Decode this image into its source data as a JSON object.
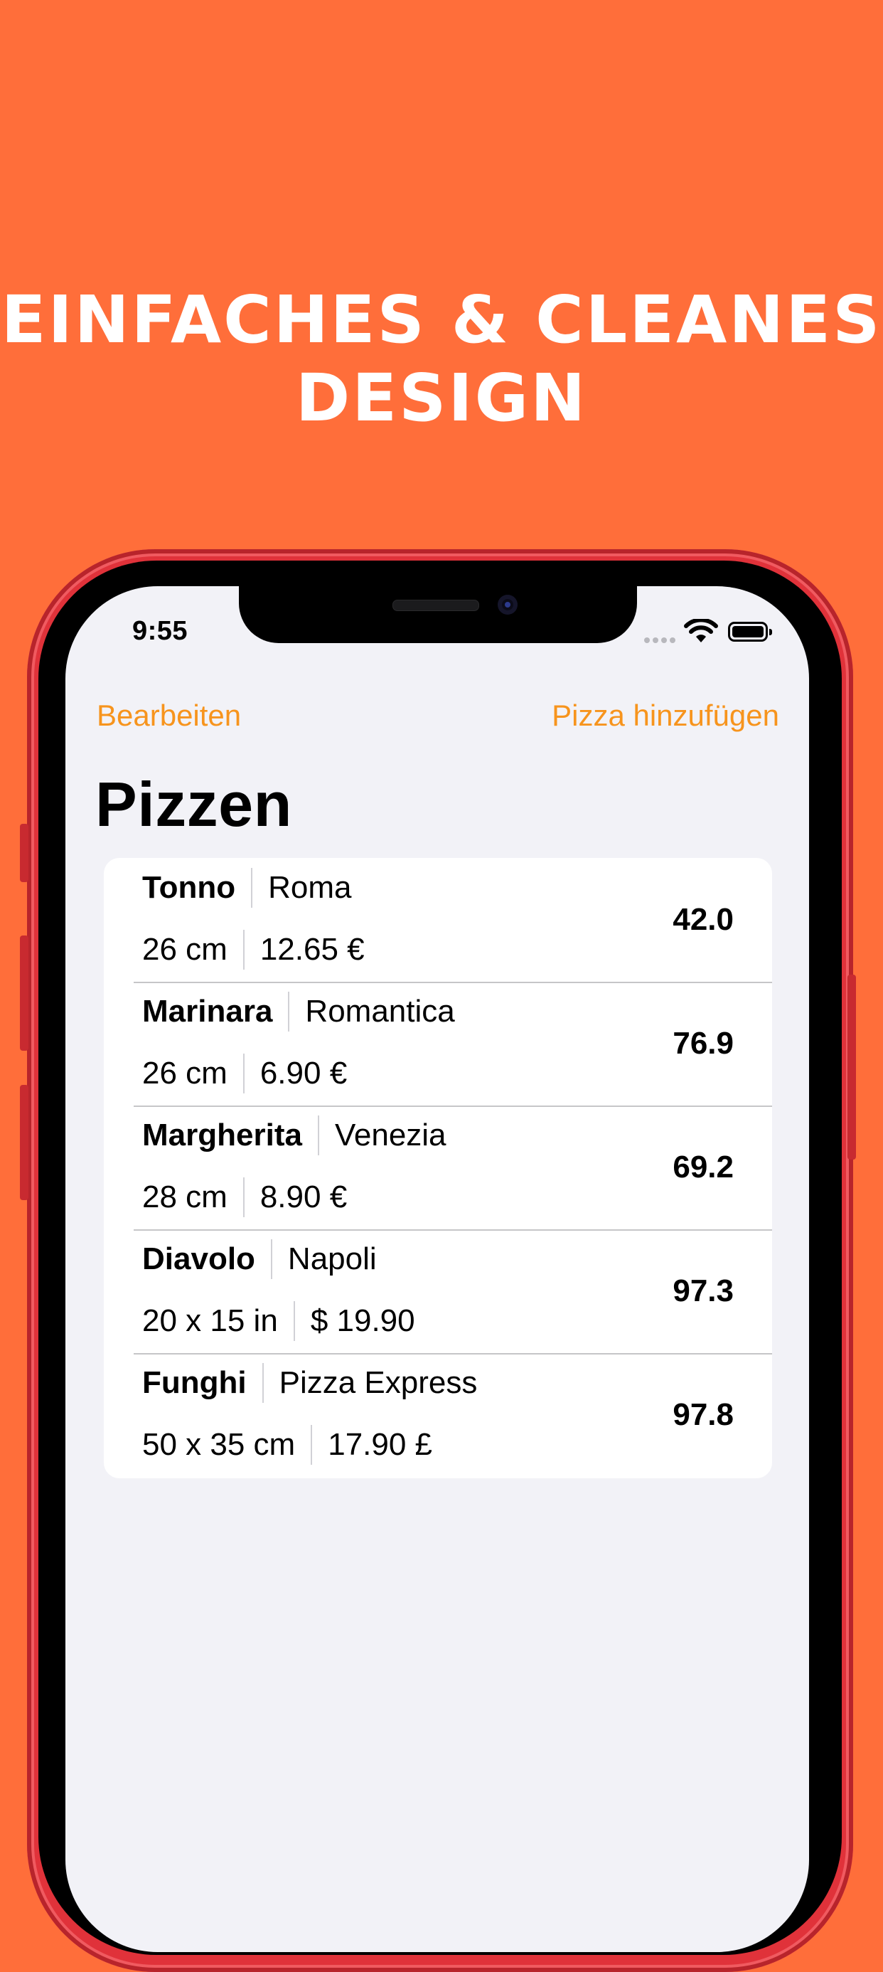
{
  "headline": {
    "line1": "EINFACHES & CLEANES",
    "line2": "DESIGN"
  },
  "status": {
    "time": "9:55"
  },
  "nav": {
    "edit_label": "Bearbeiten",
    "add_label": "Pizza hinzufügen",
    "title": "Pizzen"
  },
  "pizzas": [
    {
      "name": "Tonno",
      "restaurant": "Roma",
      "size": "26 cm",
      "price": "12.65 €",
      "rating": "42.0"
    },
    {
      "name": "Marinara",
      "restaurant": "Romantica",
      "size": "26 cm",
      "price": "6.90 €",
      "rating": "76.9"
    },
    {
      "name": "Margherita",
      "restaurant": "Venezia",
      "size": "28 cm",
      "price": "8.90 €",
      "rating": "69.2"
    },
    {
      "name": "Diavolo",
      "restaurant": "Napoli",
      "size": "20 x 15 in",
      "price": "$ 19.90",
      "rating": "97.3"
    },
    {
      "name": "Funghi",
      "restaurant": "Pizza Express",
      "size": "50 x 35 cm",
      "price": "17.90 £",
      "rating": "97.8"
    }
  ],
  "colors": {
    "background": "#FF6E3A",
    "accent": "#F7941D",
    "phone_frame": "#E0323A",
    "screen": "#F2F2F7"
  }
}
